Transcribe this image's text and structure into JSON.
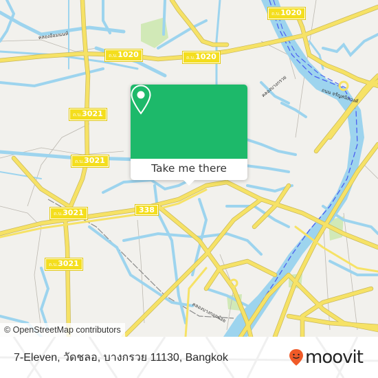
{
  "map": {
    "road_shields": [
      {
        "prefix": "ถ.บ.",
        "number": "1020"
      },
      {
        "prefix": "ถ.บ.",
        "number": "1020"
      },
      {
        "prefix": "ถ.บ.",
        "number": "1020"
      },
      {
        "prefix": "ถ.บ.",
        "number": "3021"
      },
      {
        "prefix": "ถ.บ.",
        "number": "3021"
      },
      {
        "prefix": "ถ.บ.",
        "number": "3021"
      },
      {
        "prefix": "ถ.บ.",
        "number": "3021"
      },
      {
        "prefix": "",
        "number": "338"
      }
    ],
    "canal_labels": [
      "คลองอ้อมนนท์",
      "คลองบางกรวย",
      "คลองบางกอกน้อย",
      "ถนน จรัญสนิทวงศ์"
    ],
    "attribution": "© OpenStreetMap contributors",
    "colors": {
      "land": "#f2f1ed",
      "water": "#9dd4ee",
      "road": "#f6e266",
      "river_route": "#4a5ff0",
      "park": "#cde8b0"
    }
  },
  "popup": {
    "icon": "map-pin-icon",
    "button_label": "Take me there",
    "color": "#1db96a"
  },
  "footer": {
    "address": "7-Eleven, วัดชลอ, บางกรวย 11130, Bangkok",
    "brand": "moovit",
    "brand_icon": "moovit-smiley-pin-icon",
    "brand_color": "#f05a28"
  }
}
